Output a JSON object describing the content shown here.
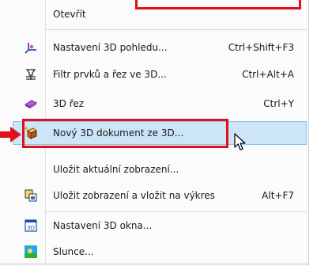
{
  "menu": {
    "items": [
      {
        "label": "Otevřít",
        "shortcut": "",
        "icon": "none"
      },
      {
        "label": "Nastavení 3D pohledu...",
        "shortcut": "Ctrl+Shift+F3",
        "icon": "3d-view-axes-icon"
      },
      {
        "label": "Filtr prvků a řez ve 3D...",
        "shortcut": "Ctrl+Alt+A",
        "icon": "filter-cut-icon"
      },
      {
        "label": "3D řez",
        "shortcut": "Ctrl+Y",
        "icon": "3d-cut-icon"
      },
      {
        "label": "Nový 3D dokument ze 3D...",
        "shortcut": "",
        "icon": "new-3d-document-icon"
      },
      {
        "label": "Uložit aktuální zobrazení...",
        "shortcut": "",
        "icon": "none"
      },
      {
        "label": "Uložit zobrazení a vložit na výkres",
        "shortcut": "Alt+F7",
        "icon": "save-place-on-drawing-icon"
      },
      {
        "label": "Nastavení 3D okna...",
        "shortcut": "",
        "icon": "3d-window-settings-icon"
      },
      {
        "label": "Slunce...",
        "shortcut": "",
        "icon": "sun-icon"
      }
    ],
    "highlighted_index": 4
  },
  "colors": {
    "highlight": "#cde6f7",
    "callout_red": "#e0101d"
  }
}
